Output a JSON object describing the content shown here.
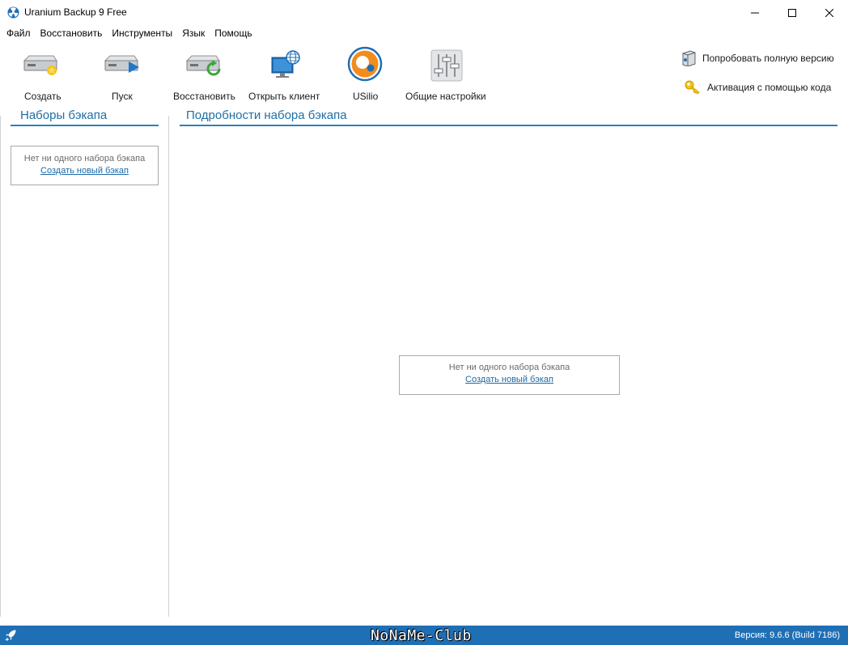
{
  "window": {
    "title": "Uranium Backup 9 Free"
  },
  "menu": {
    "items": [
      "Файл",
      "Восстановить",
      "Инструменты",
      "Язык",
      "Помощь"
    ]
  },
  "toolbar": {
    "create": "Создать",
    "run": "Пуск",
    "restore": "Восстановить",
    "open_client": "Открыть клиент",
    "usilio": "USilio",
    "settings": "Общие настройки"
  },
  "actions": {
    "try_full": "Попробовать полную версию",
    "activate": "Активация с помощью кода"
  },
  "left_panel": {
    "title": "Наборы бэкапа",
    "empty_message": "Нет ни одного набора бэкапа",
    "create_link": "Создать новый бэкап"
  },
  "main_panel": {
    "title": "Подробности набора бэкапа",
    "empty_message": "Нет ни одного набора бэкапа",
    "create_link": "Создать новый бэкап"
  },
  "status": {
    "version": "Версия: 9.6.6 (Build 7186)",
    "watermark": "NoNaMe-Club"
  },
  "colors": {
    "accent": "#1f6fb5",
    "heading": "#1e6fa6",
    "link": "#1a6aa8"
  }
}
